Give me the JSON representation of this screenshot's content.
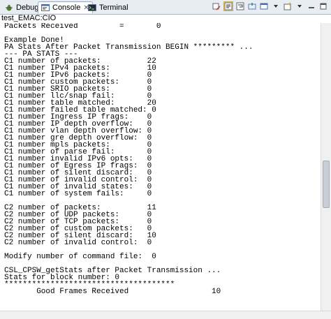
{
  "tabs": [
    {
      "label": "Debug",
      "icon": "debug-icon"
    },
    {
      "label": "Console",
      "icon": "console-icon",
      "active": true
    },
    {
      "label": "Terminal",
      "icon": "terminal-icon"
    }
  ],
  "tab_close": "✕",
  "toolbar_icons": [
    "clear-console-icon",
    "scroll-lock-icon",
    "word-wrap-icon",
    "pin-console-icon",
    "display-console-icon",
    "open-console-icon",
    "new-console-icon",
    "minimize-icon",
    "maximize-icon"
  ],
  "console_name": "test_EMAC:CIO",
  "lines": [
    "Packets Received         =       0",
    "",
    "Example Done!",
    "PA Stats After Packet Transmission BEGIN ********* ...",
    "--- PA STATS ---",
    "C1 number of packets:          22",
    "C1 number IPv4 packets:        10",
    "C1 number IPv6 packets:        0",
    "C1 number custom packets:      0",
    "C1 number SRIO packets:        0",
    "C1 number llc/snap fail:       0",
    "C1 number table matched:       20",
    "C1 number failed table matched: 0",
    "C1 number Ingress IP frags:    0",
    "C1 number IP depth overflow:   0",
    "C1 number vlan depth overflow: 0",
    "C1 number gre depth overflow:  0",
    "C1 number mpls packets:        0",
    "C1 number of parse fail:       0",
    "C1 number invalid IPv6 opts:   0",
    "C1 number of Egress IP frags:  0",
    "C1 number of silent discard:   0",
    "C1 number of invalid control:  0",
    "C1 number of invalid states:   0",
    "C1 number of system fails:     0",
    "",
    "C2 number of packets:          11",
    "C2 number of UDP packets:      0",
    "C2 number of TCP packets:      0",
    "C2 number of custom packets:   0",
    "C2 number of silent discard:   10",
    "C2 number of invalid control:  0",
    "",
    "Modify number of command file:  0",
    "",
    "CSL_CPSW_getStats after Packet Transmission ...",
    "Stats for block number: 0",
    "*************************************",
    "       Good Frames Received                  10"
  ]
}
